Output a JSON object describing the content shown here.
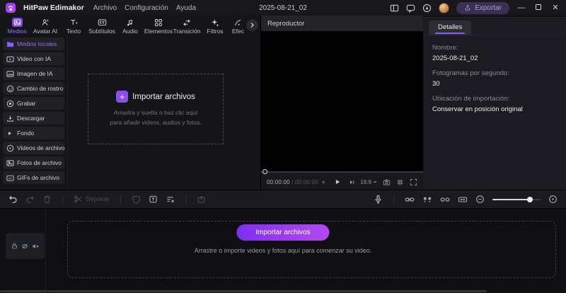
{
  "titlebar": {
    "app_name": "HitPaw Edimakor",
    "menus": [
      "Archivo",
      "Configuración",
      "Ayuda"
    ],
    "document_title": "2025-08-21_02",
    "export_label": "Exportar",
    "window": {
      "minimize": "—",
      "close": "✕"
    }
  },
  "tabs": {
    "items": [
      {
        "label": "Medios",
        "active": true
      },
      {
        "label": "Avatar AI"
      },
      {
        "label": "Texto"
      },
      {
        "label": "Subtítulos"
      },
      {
        "label": "Audio"
      },
      {
        "label": "Elementos"
      },
      {
        "label": "Transición"
      },
      {
        "label": "Filtros"
      },
      {
        "label": "Efec"
      }
    ]
  },
  "sidebar": {
    "items": [
      {
        "label": "Medios locales",
        "active": true
      },
      {
        "label": "Video con IA"
      },
      {
        "label": "Imagen de IA"
      },
      {
        "label": "Cambio de rostro"
      },
      {
        "label": "Grabar"
      },
      {
        "label": "Descargar"
      },
      {
        "label": "Fondo"
      },
      {
        "label": "Videos de archivo"
      },
      {
        "label": "Fotos de archivo"
      },
      {
        "label": "GIFs de archivo"
      }
    ]
  },
  "media_panel": {
    "plus_glyph": "+",
    "import_title": "Importar archivos",
    "hint_line1": "Arrastra y suelta o haz clic aquí",
    "hint_line2": "para añadir videos, audios y fotos."
  },
  "player": {
    "title": "Reproductor",
    "current_time": "00:00:00",
    "time_separator": " / ",
    "total_time": "00:00:00",
    "aspect_ratio": "16:9"
  },
  "details": {
    "tab_label": "Detalles",
    "fields": [
      {
        "label": "Nombre:",
        "value": "2025-08-21_02"
      },
      {
        "label": "Fotogramas por segundo:",
        "value": "30"
      },
      {
        "label": "Ubicación de importación:",
        "value": "Conservar en posición original"
      }
    ]
  },
  "timeline_toolbar": {
    "separate_label": "Separar"
  },
  "timeline": {
    "import_button_label": "Importar archivos",
    "import_hint": "Arrastre o importe videos y fotos aquí para comenzar su video."
  },
  "colors": {
    "accent": "#8b5cf6",
    "tab_active_bg": "#7e46e8",
    "button_gradient_start": "#7e2ef0",
    "button_gradient_end": "#b44af0",
    "export_button_bg": "#3b3054"
  }
}
